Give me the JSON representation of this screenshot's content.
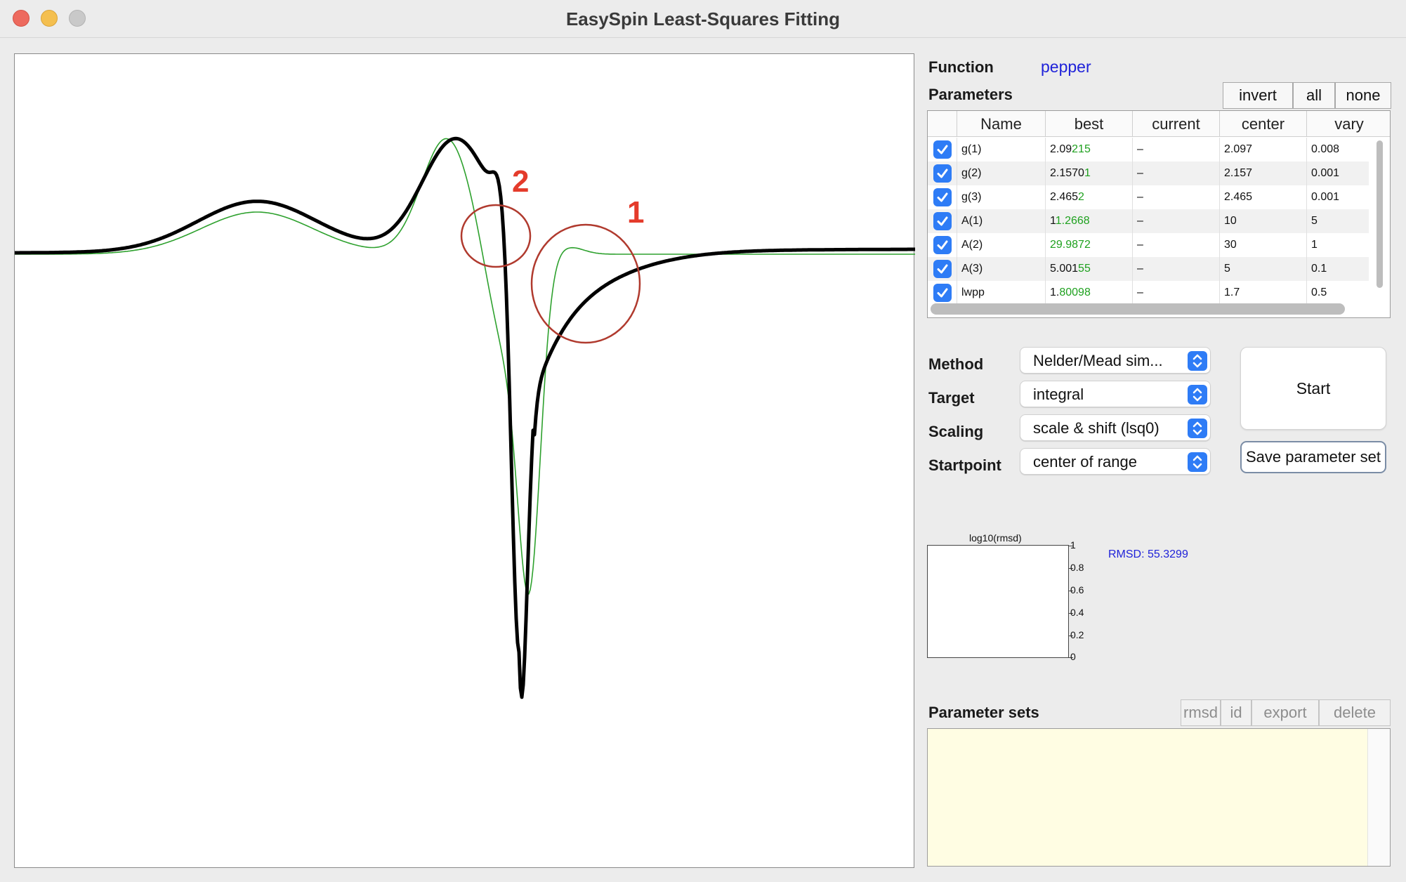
{
  "window": {
    "title": "EasySpin Least-Squares Fitting"
  },
  "function": {
    "label": "Function",
    "value": "pepper"
  },
  "parameters": {
    "label": "Parameters",
    "buttons": [
      "invert",
      "all",
      "none"
    ],
    "columns": [
      "Name",
      "best",
      "current",
      "center",
      "vary"
    ],
    "rows": [
      {
        "checked": true,
        "name": "g(1)",
        "best_prefix": "2.09",
        "best_suffix": "215",
        "current": "–",
        "center": "2.097",
        "vary": "0.008"
      },
      {
        "checked": true,
        "name": "g(2)",
        "best_prefix": "2.1570",
        "best_suffix": "1",
        "current": "–",
        "center": "2.157",
        "vary": "0.001"
      },
      {
        "checked": true,
        "name": "g(3)",
        "best_prefix": "2.465",
        "best_suffix": "2",
        "current": "–",
        "center": "2.465",
        "vary": "0.001"
      },
      {
        "checked": true,
        "name": "A(1)",
        "best_prefix": "1",
        "best_suffix": "1.2668",
        "current": "–",
        "center": "10",
        "vary": "5"
      },
      {
        "checked": true,
        "name": "A(2)",
        "best_prefix": "",
        "best_suffix": "29.9872",
        "current": "–",
        "center": "30",
        "vary": "1"
      },
      {
        "checked": true,
        "name": "A(3)",
        "best_prefix": "5.001",
        "best_suffix": "55",
        "current": "–",
        "center": "5",
        "vary": "0.1"
      },
      {
        "checked": true,
        "name": "lwpp",
        "best_prefix": "1.",
        "best_suffix": "80098",
        "current": "–",
        "center": "1.7",
        "vary": "0.5"
      }
    ]
  },
  "settings": {
    "method": {
      "label": "Method",
      "value": "Nelder/Mead sim..."
    },
    "target": {
      "label": "Target",
      "value": "integral"
    },
    "scaling": {
      "label": "Scaling",
      "value": "scale & shift (lsq0)"
    },
    "startpoint": {
      "label": "Startpoint",
      "value": "center of range"
    }
  },
  "actions": {
    "start": "Start",
    "save": "Save parameter set"
  },
  "rmsd_plot": {
    "title": "log10(rmsd)",
    "ticks": [
      "1",
      "0.8",
      "0.6",
      "0.4",
      "0.2",
      "0"
    ],
    "readout": "RMSD: 55.3299"
  },
  "parameter_sets": {
    "label": "Parameter sets",
    "buttons": [
      "rmsd",
      "id",
      "export",
      "delete"
    ]
  },
  "annotations": [
    "2",
    "1"
  ],
  "colors": {
    "experimental": "#000000",
    "simulated": "#2ea12e",
    "annotation": "#b03a2e",
    "annotation_text": "#e43b2b",
    "accent": "#2e7cf6",
    "link_blue": "#1f22d9"
  },
  "chart_data": {
    "type": "line",
    "title": "",
    "xlabel": "",
    "ylabel": "",
    "series": [
      {
        "values": []
      },
      {
        "values": []
      }
    ]
  }
}
